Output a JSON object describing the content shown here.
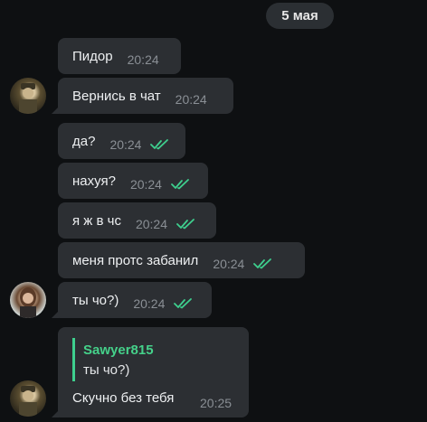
{
  "date_label": "5 мая",
  "colors": {
    "background": "#0e1012",
    "bubble": "#2c2f33",
    "read_check": "#3ecf8e",
    "reply_accent": "#45d18a"
  },
  "messages": [
    {
      "text": "Пидор",
      "time": "20:24",
      "read": false
    },
    {
      "text": "Вернись в чат",
      "time": "20:24",
      "read": false
    },
    {
      "text": "да?",
      "time": "20:24",
      "read": true
    },
    {
      "text": "нахуя?",
      "time": "20:24",
      "read": true
    },
    {
      "text": "я ж в чс",
      "time": "20:24",
      "read": true
    },
    {
      "text": "меня протс забанил",
      "time": "20:24",
      "read": true
    },
    {
      "text": "ты чо?)",
      "time": "20:24",
      "read": true
    }
  ],
  "reply": {
    "quote_author": "Sawyer815",
    "quote_text": "ты чо?)",
    "text": "Скучно без тебя",
    "time": "20:25"
  },
  "icons": {
    "check": "double-check-icon",
    "avatar": "user-avatar"
  }
}
